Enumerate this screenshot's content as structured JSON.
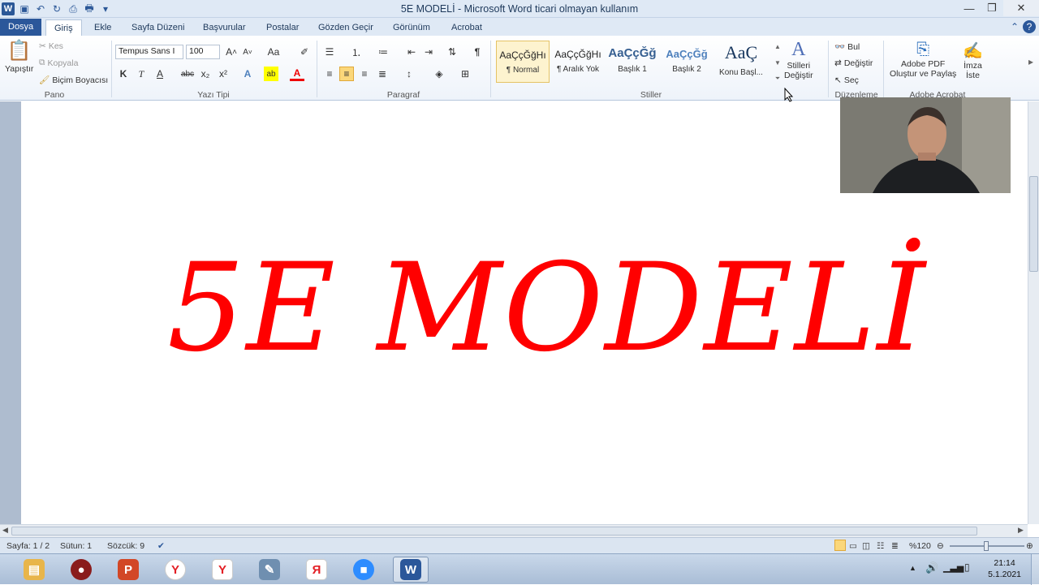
{
  "window": {
    "title": "5E MODELİ  -  Microsoft Word ticari olmayan kullanım",
    "controls": [
      "minimize-icon",
      "restore-icon",
      "close-icon"
    ]
  },
  "tabs": [
    {
      "label": "Dosya",
      "type": "file"
    },
    {
      "label": "Giriş",
      "active": true
    },
    {
      "label": "Ekle"
    },
    {
      "label": "Sayfa Düzeni"
    },
    {
      "label": "Başvurular"
    },
    {
      "label": "Postalar"
    },
    {
      "label": "Gözden Geçir"
    },
    {
      "label": "Görünüm"
    },
    {
      "label": "Acrobat"
    }
  ],
  "ribbon": {
    "clipboard": {
      "label": "Pano",
      "paste": "Yapıştır",
      "cut": "Kes",
      "copy": "Kopyala",
      "format_painter": "Biçim Boyacısı"
    },
    "font": {
      "label": "Yazı Tipi",
      "font_name": "Tempus Sans I",
      "font_size": "100",
      "bold": "K",
      "italic": "T",
      "underline": "A",
      "strikethrough": "abc",
      "subscript": "x₂",
      "superscript": "x²"
    },
    "paragraph": {
      "label": "Paragraf",
      "pilcrow": "¶"
    },
    "styles": {
      "label": "Stiller",
      "items": [
        {
          "sample": "AaÇçĞğHı",
          "name": "¶ Normal",
          "selected": true
        },
        {
          "sample": "AaÇçĞğHı",
          "name": "¶ Aralık Yok"
        },
        {
          "sample": "AaÇçĞğ",
          "name": "Başlık 1"
        },
        {
          "sample": "AaÇçĞğ",
          "name": "Başlık 2"
        },
        {
          "sample": "AaÇ",
          "name": "Konu Başl..."
        }
      ],
      "change_styles_line1": "Stilleri",
      "change_styles_line2": "Değiştir"
    },
    "editing": {
      "label": "Düzenleme",
      "find": "Bul",
      "replace": "Değiştir",
      "select": "Seç"
    },
    "acrobat": {
      "label": "Adobe Acrobat",
      "create_line1": "Adobe PDF",
      "create_line2": "Oluştur ve Paylaş",
      "sign_line1": "İmza",
      "sign_line2": "İste"
    }
  },
  "document": {
    "heading": "5E MODELİ",
    "heading_color": "#ff0000"
  },
  "statusbar": {
    "page": "Sayfa: 1 / 2",
    "column": "Sütun: 1",
    "words": "Sözcük: 9",
    "zoom": "%120"
  },
  "taskbar": {
    "apps": [
      {
        "name": "explorer",
        "glyph": "▤",
        "color": "#e8b54a"
      },
      {
        "name": "media-player",
        "glyph": "●",
        "color": "#8a1c1c"
      },
      {
        "name": "powerpoint",
        "glyph": "P",
        "color": "#d24726"
      },
      {
        "name": "yandex-browser",
        "glyph": "Y",
        "color": "#e31e24"
      },
      {
        "name": "yandex-browser-2",
        "glyph": "Y",
        "color": "#e31e24"
      },
      {
        "name": "paint-tool",
        "glyph": "✎",
        "color": "#6f8fb0"
      },
      {
        "name": "yandex",
        "glyph": "Я",
        "color": "#e31e24"
      },
      {
        "name": "zoom",
        "glyph": "■",
        "color": "#2d8cff"
      },
      {
        "name": "word",
        "glyph": "W",
        "color": "#2b579a",
        "active": true
      }
    ],
    "time": "21:14",
    "date": "5.1.2021"
  },
  "colors": {
    "accent": "#2b579a",
    "title_red": "#ff0000"
  }
}
